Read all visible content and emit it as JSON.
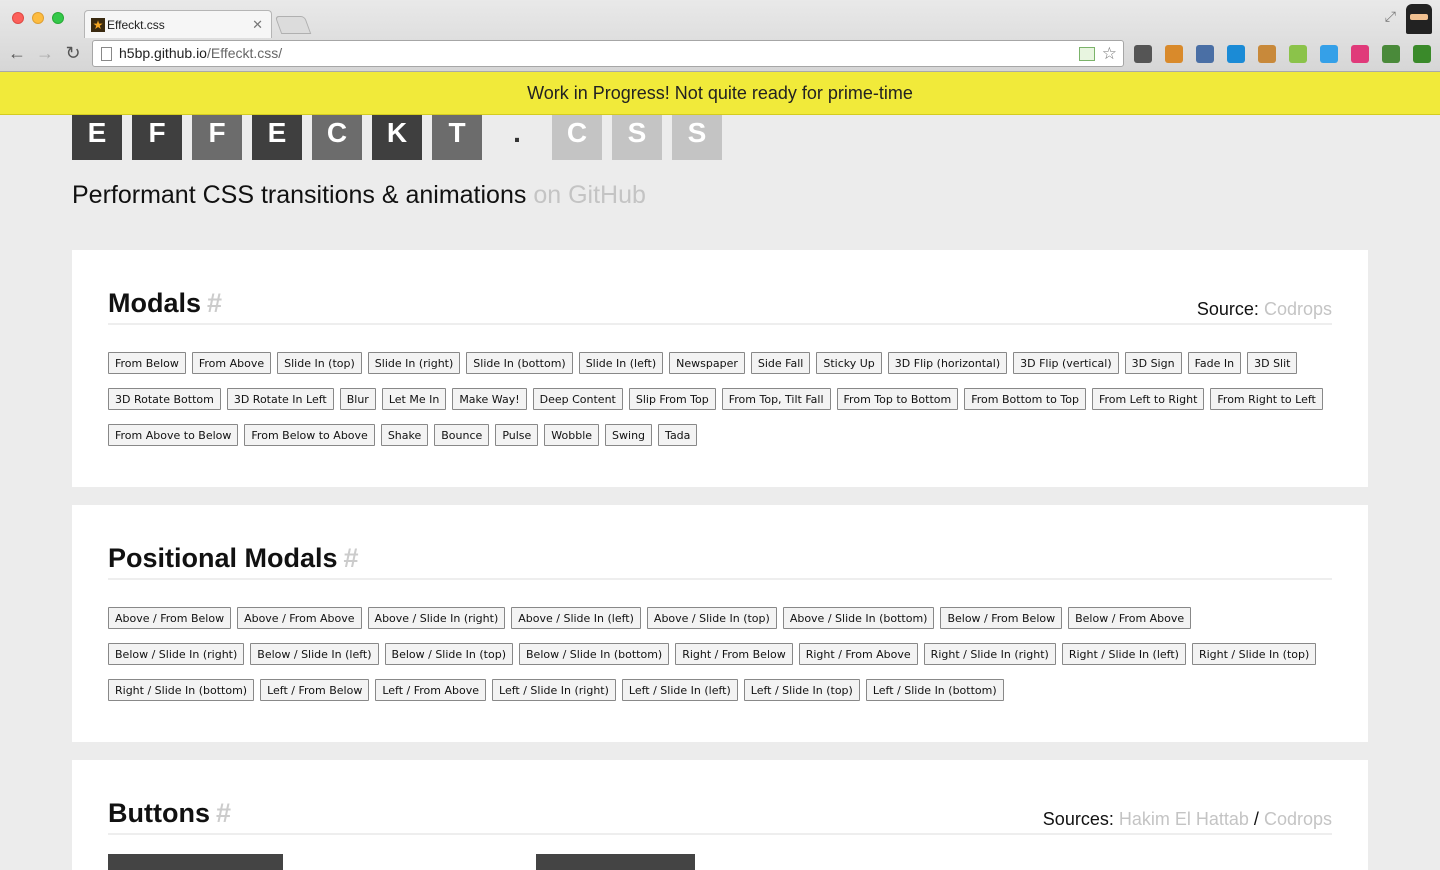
{
  "browser": {
    "tab_title": "Effeckt.css",
    "url_host": "h5bp.github.io",
    "url_path": "/Effeckt.css/",
    "extensions": [
      {
        "name": "pocket-icon",
        "color": "#555"
      },
      {
        "name": "cookie-icon",
        "color": "#d98a2b"
      },
      {
        "name": "window-icon",
        "color": "#4a6fa5"
      },
      {
        "name": "screen-icon",
        "color": "#1b8bd6"
      },
      {
        "name": "bag-icon",
        "color": "#c8893a"
      },
      {
        "name": "android-icon",
        "color": "#8bc34a"
      },
      {
        "name": "v-icon",
        "color": "#35a0e8"
      },
      {
        "name": "colorwheel-icon",
        "color": "#e03a7a"
      },
      {
        "name": "eyedropper-icon",
        "color": "#4a8a3a"
      },
      {
        "name": "menu-icon",
        "color": "#3a8a2a"
      }
    ]
  },
  "banner": "Work in Progress! Not quite ready for prime-time",
  "logo": {
    "letters": [
      {
        "ch": "E",
        "tone": "dark"
      },
      {
        "ch": "F",
        "tone": "dark"
      },
      {
        "ch": "F",
        "tone": "mid"
      },
      {
        "ch": "E",
        "tone": "dark"
      },
      {
        "ch": "C",
        "tone": "mid"
      },
      {
        "ch": "K",
        "tone": "dark"
      },
      {
        "ch": "T",
        "tone": "mid"
      },
      {
        "ch": ".",
        "tone": "dot"
      },
      {
        "ch": "C",
        "tone": "light"
      },
      {
        "ch": "S",
        "tone": "light"
      },
      {
        "ch": "S",
        "tone": "light"
      }
    ]
  },
  "tagline": {
    "text": "Performant CSS transitions & animations",
    "link": "on GitHub"
  },
  "modals": {
    "title": "Modals",
    "hash": "#",
    "source_label": "Source:",
    "source_link": "Codrops",
    "buttons": [
      "From Below",
      "From Above",
      "Slide In (top)",
      "Slide In (right)",
      "Slide In (bottom)",
      "Slide In (left)",
      "Newspaper",
      "Side Fall",
      "Sticky Up",
      "3D Flip (horizontal)",
      "3D Flip (vertical)",
      "3D Sign",
      "Fade In",
      "3D Slit",
      "3D Rotate Bottom",
      "3D Rotate In Left",
      "Blur",
      "Let Me In",
      "Make Way!",
      "Deep Content",
      "Slip From Top",
      "From Top, Tilt Fall",
      "From Top to Bottom",
      "From Bottom to Top",
      "From Left to Right",
      "From Right to Left",
      "From Above to Below",
      "From Below to Above",
      "Shake",
      "Bounce",
      "Pulse",
      "Wobble",
      "Swing",
      "Tada"
    ]
  },
  "positional": {
    "title": "Positional Modals",
    "hash": "#",
    "buttons": [
      "Above / From Below",
      "Above / From Above",
      "Above / Slide In (right)",
      "Above / Slide In (left)",
      "Above / Slide In (top)",
      "Above / Slide In (bottom)",
      "Below / From Below",
      "Below / From Above",
      "Below / Slide In (right)",
      "Below / Slide In (left)",
      "Below / Slide In (top)",
      "Below / Slide In (bottom)",
      "Right / From Below",
      "Right / From Above",
      "Right / Slide In (right)",
      "Right / Slide In (left)",
      "Right / Slide In (top)",
      "Right / Slide In (bottom)",
      "Left / From Below",
      "Left / From Above",
      "Left / Slide In (right)",
      "Left / Slide In (left)",
      "Left / Slide In (top)",
      "Left / Slide In (bottom)"
    ]
  },
  "buttons_section": {
    "title": "Buttons",
    "hash": "#",
    "source_label": "Sources:",
    "source_link_1": "Hakim El Hattab",
    "separator": "/",
    "source_link_2": "Codrops"
  }
}
